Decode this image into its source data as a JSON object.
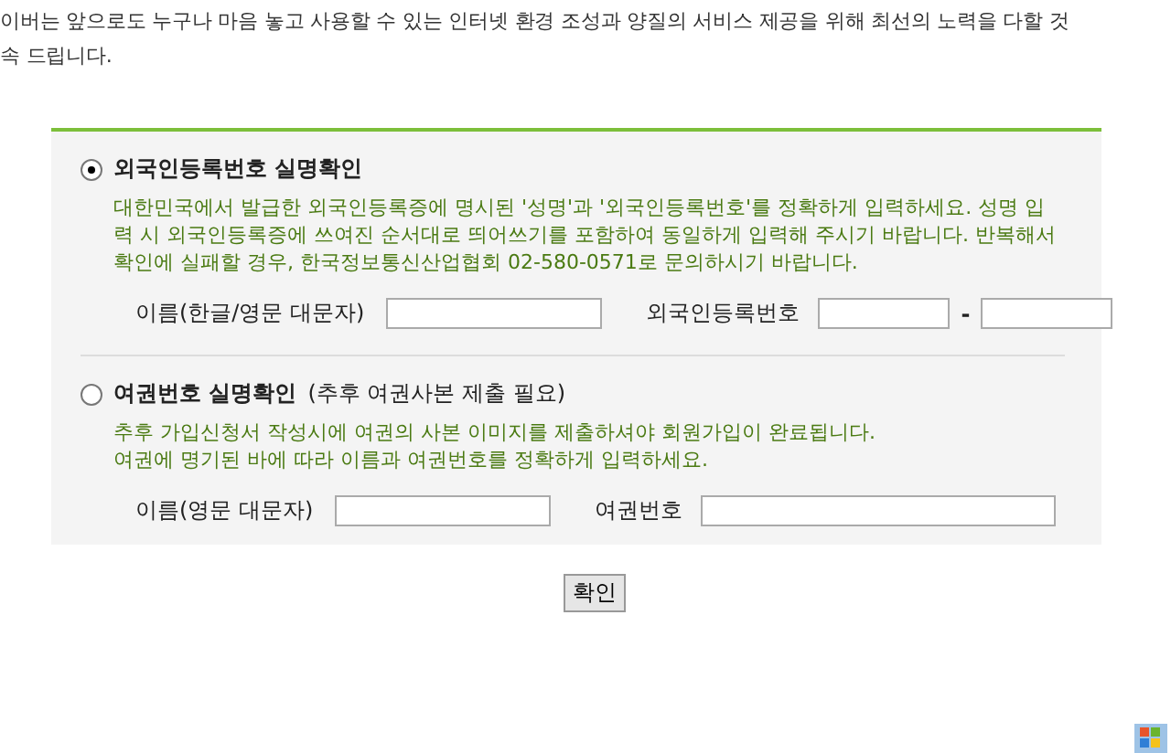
{
  "notice": {
    "lines": [
      "이버는 앞으로도 누구나 마음 놓고 사용할 수 있는 인터넷 환경 조성과 양질의 서비스 제공을 위해 최선의 노력을 다할 것",
      "속 드립니다."
    ]
  },
  "options": [
    {
      "selected": true,
      "title": "외국인등록번호 실명확인",
      "description": "대한민국에서 발급한 외국인등록증에 명시된 '성명'과 '외국인등록번호'를 정확하게 입력하세요. 성명 입력 시 외국인등록증에 쓰여진 순서대로 띄어쓰기를 포함하여 동일하게 입력해 주시기 바랍니다. 반복해서 확인에 실패할 경우, 한국정보통신산업협회 02-580-0571로 문의하시기 바랍니다.",
      "fields": [
        {
          "kind": "single",
          "label": "이름(한글/영문 대문자)"
        },
        {
          "kind": "split",
          "label": "외국인등록번호",
          "separator": "-"
        }
      ]
    },
    {
      "selected": false,
      "title": "여권번호 실명확인",
      "note": "(추후 여권사본 제출 필요)",
      "description": "추후 가입신청서 작성시에 여권의 사본 이미지를 제출하셔야 회원가입이 완료됩니다.\n여권에 명기된 바에 따라 이름과 여권번호를 정확하게 입력하세요.",
      "fields": [
        {
          "kind": "single",
          "label": "이름(영문 대문자)"
        },
        {
          "kind": "wide",
          "label": "여권번호"
        }
      ]
    }
  ],
  "confirm_button": "확인"
}
